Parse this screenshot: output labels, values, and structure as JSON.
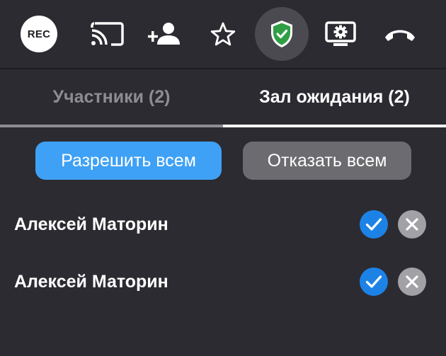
{
  "toolbar": {
    "rec_label": "REC",
    "icons": [
      "record-icon",
      "cast-icon",
      "add-user-icon",
      "star-icon",
      "shield-check-icon",
      "screen-settings-icon",
      "end-call-icon"
    ],
    "colors": {
      "shield": "#2f9e44",
      "active_bg": "#4a4a50"
    }
  },
  "tabs": [
    {
      "label": "Участники (2)",
      "active": false
    },
    {
      "label": "Зал ожидания (2)",
      "active": true
    }
  ],
  "actions": {
    "allow_all": "Разрешить всем",
    "deny_all": "Отказать всем"
  },
  "waiting": [
    {
      "name": "Алексей Маторин"
    },
    {
      "name": "Алексей Маторин"
    }
  ],
  "colors": {
    "background": "#2b2b31",
    "accent": "#3ea1f5",
    "accept": "#1d82e6",
    "reject": "#a2a2a6"
  }
}
